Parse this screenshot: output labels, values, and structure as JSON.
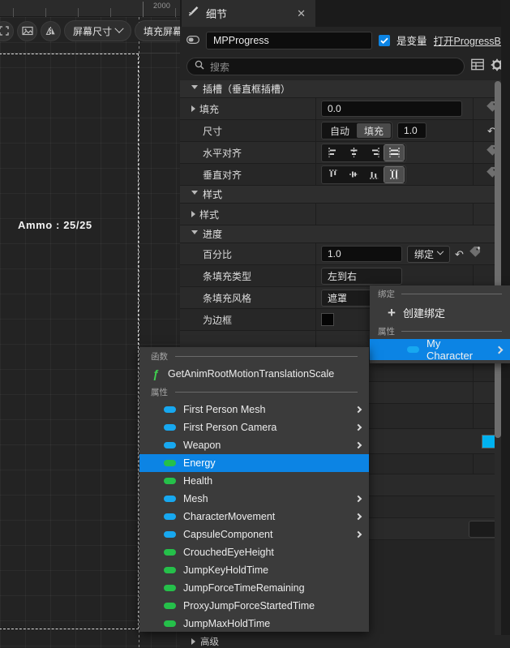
{
  "viewport": {
    "ruler_label": "2000",
    "toolbar": [
      {
        "name": "fit-screen-icon",
        "label": ""
      },
      {
        "name": "image-icon",
        "label": ""
      },
      {
        "name": "mirror-icon",
        "label": ""
      }
    ],
    "screen_size_label": "屏幕尺寸",
    "fill_screen_label": "填充屏幕",
    "ammo_text": "Ammo : 25/25"
  },
  "details": {
    "tab_label": "细节",
    "tab_close": "✕",
    "widget_name": "MPProgress",
    "is_variable_label": "是变量",
    "open_link_label": "打开ProgressBa",
    "search_placeholder": "搜索",
    "categories": {
      "slot": "插槽（垂直框插槽）",
      "style": "样式",
      "progress": "进度"
    },
    "rows": {
      "padding": {
        "label": "填充",
        "value": "0.0"
      },
      "size": {
        "label": "尺寸",
        "auto": "自动",
        "fill": "填充",
        "amount": "1.0"
      },
      "halign": {
        "label": "水平对齐"
      },
      "valign": {
        "label": "垂直对齐"
      },
      "style_sub": {
        "label": "样式"
      },
      "percent": {
        "label": "百分比",
        "value": "1.0",
        "bind": "绑定"
      },
      "bar_fill_type": {
        "label": "条填充类型",
        "value": "左到右"
      },
      "bar_fill_style": {
        "label": "条填充风格",
        "value": "遮罩"
      },
      "is_marquee": {
        "label": "为边框"
      },
      "bind_label": "绑定"
    },
    "advanced_label": "高级"
  },
  "bind_popup": {
    "section_bind": "绑定",
    "create_binding": "创建绑定",
    "section_property": "属性",
    "selected_item": "My Character"
  },
  "property_popup": {
    "section_function": "函数",
    "function_item": "GetAnimRootMotionTranslationScale",
    "section_property": "属性",
    "items": [
      {
        "label": "First Person Mesh",
        "kind": "object",
        "submenu": true,
        "selected": false
      },
      {
        "label": "First Person Camera",
        "kind": "object",
        "submenu": true,
        "selected": false
      },
      {
        "label": "Weapon",
        "kind": "object",
        "submenu": true,
        "selected": false
      },
      {
        "label": "Energy",
        "kind": "value",
        "submenu": false,
        "selected": true
      },
      {
        "label": "Health",
        "kind": "value",
        "submenu": false,
        "selected": false
      },
      {
        "label": "Mesh",
        "kind": "object",
        "submenu": true,
        "selected": false
      },
      {
        "label": "CharacterMovement",
        "kind": "object",
        "submenu": true,
        "selected": false
      },
      {
        "label": "CapsuleComponent",
        "kind": "object",
        "submenu": true,
        "selected": false
      },
      {
        "label": "CrouchedEyeHeight",
        "kind": "value",
        "submenu": false,
        "selected": false
      },
      {
        "label": "JumpKeyHoldTime",
        "kind": "value",
        "submenu": false,
        "selected": false
      },
      {
        "label": "JumpForceTimeRemaining",
        "kind": "value",
        "submenu": false,
        "selected": false
      },
      {
        "label": "ProxyJumpForceStartedTime",
        "kind": "value",
        "submenu": false,
        "selected": false
      },
      {
        "label": "JumpMaxHoldTime",
        "kind": "value",
        "submenu": false,
        "selected": false
      }
    ]
  },
  "colors": {
    "accent_blue": "#0c84e4",
    "object_pin": "#17a8f0",
    "value_pin": "#25c04a",
    "swatch_cyan": "#00b2f0"
  }
}
